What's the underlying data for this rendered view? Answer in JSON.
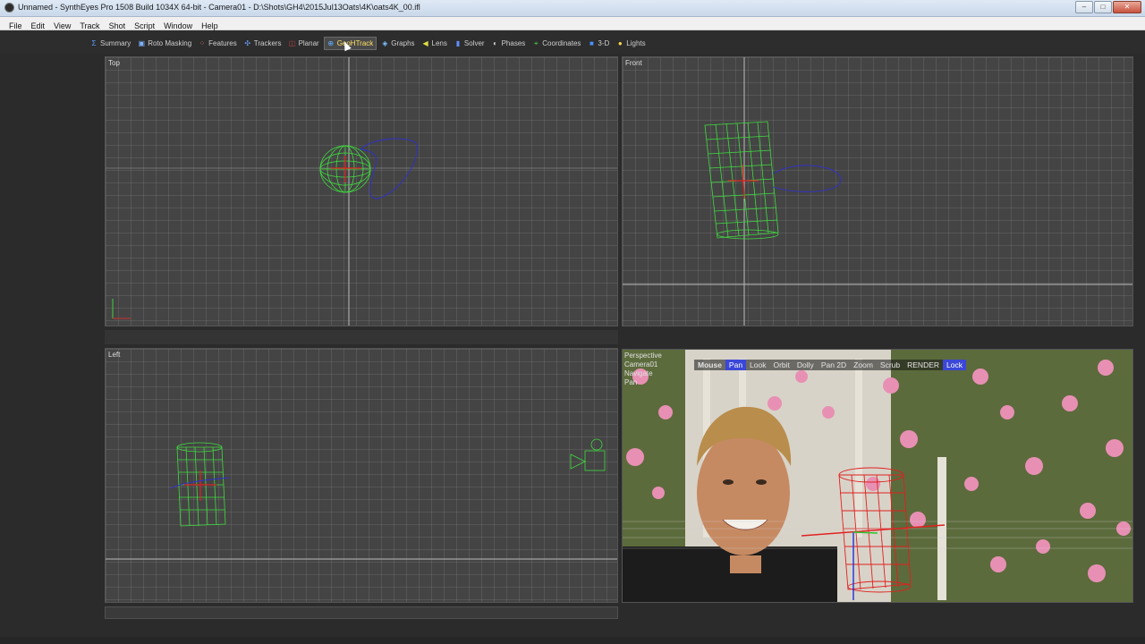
{
  "window": {
    "title": "Unnamed - SynthEyes Pro 1508 Build 1034X 64-bit - Camera01 - D:\\Shots\\GH4\\2015Jul13Oats\\4K\\oats4K_00.ifl",
    "minimize": "‒",
    "maximize": "□",
    "close": "✕"
  },
  "menu": {
    "items": [
      "File",
      "Edit",
      "View",
      "Track",
      "Shot",
      "Script",
      "Window",
      "Help"
    ]
  },
  "rooms": [
    {
      "label": "Summary",
      "icon": "sigma-icon",
      "glyph": "Σ",
      "color": "#5aa0ff"
    },
    {
      "label": "Roto Masking",
      "icon": "roto-icon",
      "glyph": "▣",
      "color": "#7fb4ff"
    },
    {
      "label": "Features",
      "icon": "features-icon",
      "glyph": "⁘",
      "color": "#d86a6a"
    },
    {
      "label": "Trackers",
      "icon": "trackers-icon",
      "glyph": "✣",
      "color": "#6aa0ff"
    },
    {
      "label": "Planar",
      "icon": "planar-icon",
      "glyph": "◫",
      "color": "#c04040"
    },
    {
      "label": "GeoHTrack",
      "icon": "geohtrack-icon",
      "glyph": "⊕",
      "color": "#60b0ff",
      "active": true
    },
    {
      "label": "Graphs",
      "icon": "graphs-icon",
      "glyph": "◈",
      "color": "#80c0ff"
    },
    {
      "label": "Lens",
      "icon": "lens-icon",
      "glyph": "◀",
      "color": "#e0e040"
    },
    {
      "label": "Solver",
      "icon": "solver-icon",
      "glyph": "▮",
      "color": "#6090ff"
    },
    {
      "label": "Phases",
      "icon": "phases-icon",
      "glyph": "◐",
      "color": "#dddddd"
    },
    {
      "label": "Coordinates",
      "icon": "coordinates-icon",
      "glyph": "⌖",
      "color": "#50d050"
    },
    {
      "label": "3-D",
      "icon": "cube-icon",
      "glyph": "■",
      "color": "#4a90ff"
    },
    {
      "label": "Lights",
      "icon": "bulb-icon",
      "glyph": "●",
      "color": "#ffd84a"
    }
  ],
  "viewports": {
    "top": {
      "label": "Top"
    },
    "front": {
      "label": "Front"
    },
    "left": {
      "label": "Left"
    },
    "perspective": {
      "lines": [
        "Perspective",
        "Camera01",
        "Navigate",
        "Pan"
      ],
      "toolbar": [
        {
          "label": "Mouse",
          "state": "bold"
        },
        {
          "label": "Pan",
          "state": "on"
        },
        {
          "label": "Look",
          "state": ""
        },
        {
          "label": "Orbit",
          "state": ""
        },
        {
          "label": "Dolly",
          "state": ""
        },
        {
          "label": "Pan 2D",
          "state": ""
        },
        {
          "label": "Zoom",
          "state": ""
        },
        {
          "label": "Scrub",
          "state": ""
        },
        {
          "label": "RENDER",
          "state": ""
        },
        {
          "label": "Lock",
          "state": "on"
        }
      ]
    }
  },
  "colors": {
    "mesh": "#3fdc3f",
    "axis_red": "#e02020",
    "tracker_blue": "#3030d0",
    "grid_line": "#bbbbbb"
  }
}
